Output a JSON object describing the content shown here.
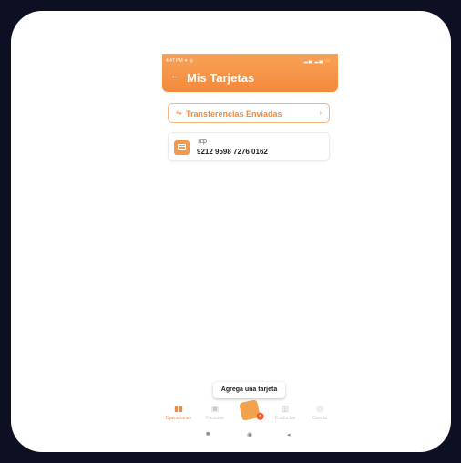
{
  "status_bar": {
    "time": "4:47 PM ✦ ◎",
    "icons": "▂▄ ▂▄ ▭"
  },
  "header": {
    "back_icon": "←",
    "title": "Mis Tarjetas"
  },
  "transfers": {
    "label": "Transferencias Enviadas"
  },
  "card_item": {
    "type": "Tcp",
    "number": "9212 9598 7276 0162"
  },
  "add_card": {
    "label": "Agrega una tarjeta"
  },
  "bottom_nav": {
    "items": [
      {
        "label": "Operaciones",
        "icon": "book-icon",
        "glyph": "▮▮"
      },
      {
        "label": "Facturas",
        "icon": "invoice-icon",
        "glyph": "▣"
      },
      {
        "label": "Productos",
        "icon": "products-icon",
        "glyph": "▥"
      },
      {
        "label": "Cuenta",
        "icon": "account-icon",
        "glyph": "◎"
      }
    ],
    "fab_badge": "+"
  },
  "system_nav": {
    "recent": "■",
    "home": "◉",
    "back": "◂"
  },
  "colors": {
    "accent": "#f3893c",
    "background": "#0d1022"
  }
}
